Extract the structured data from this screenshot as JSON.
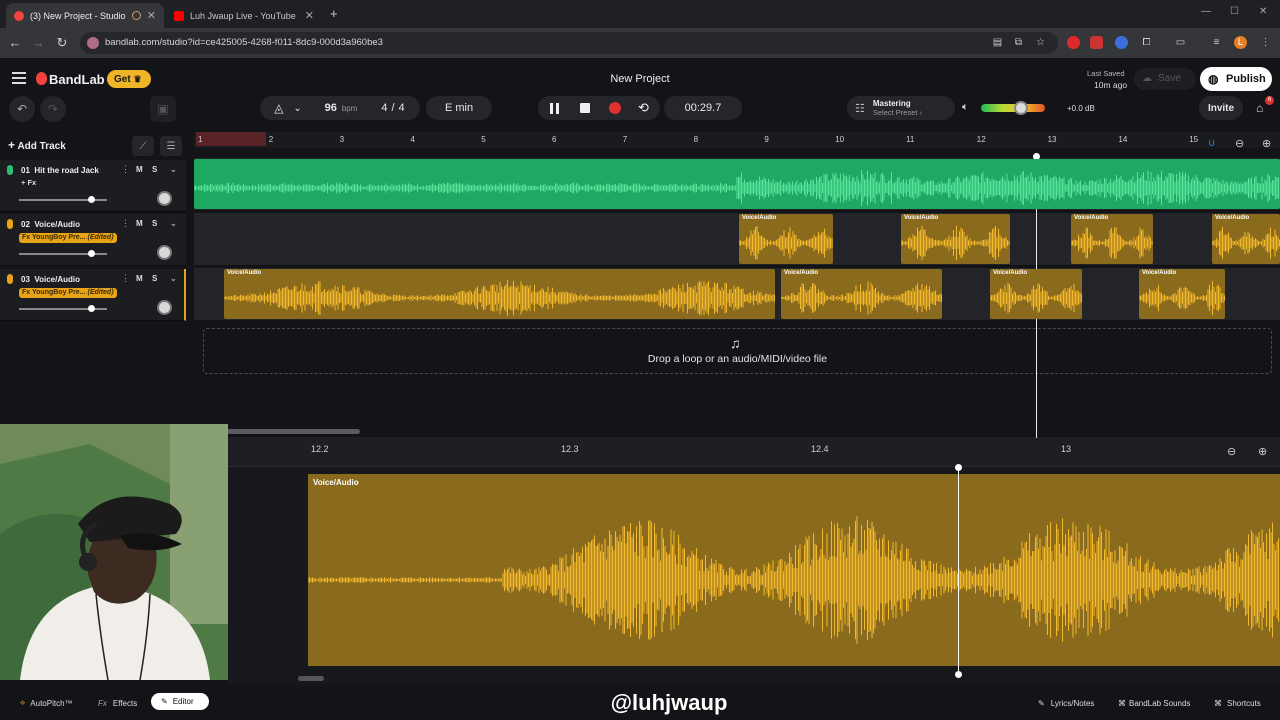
{
  "browser": {
    "tabs": [
      {
        "title": "(3) New Project - Studio",
        "active": true
      },
      {
        "title": "Luh Jwaup Live - YouTube",
        "active": false
      }
    ],
    "new_tab": "+",
    "url": "bandlab.com/studio?id=ce425005-4268-f011-8dc9-000d3a960be3",
    "profile_initial": "L"
  },
  "app": {
    "logo": "BandLab",
    "get_label": "Get",
    "project_title": "New Project",
    "last_saved_label": "Last Saved",
    "last_saved_time": "10m ago",
    "save_label": "Save",
    "publish_label": "Publish",
    "invite_label": "Invite",
    "gift_badge": "6"
  },
  "transport": {
    "bpm": "96",
    "bpm_unit": "bpm",
    "time_sig_num": "4",
    "time_sig_sep": "/",
    "time_sig_den": "4",
    "key": "E min",
    "time": "00:29.7",
    "mastering_label": "Mastering",
    "mastering_preset": "Select Preset",
    "master_db": "+0.0 dB",
    "master_level": 0.62
  },
  "tracks": [
    {
      "number": "01",
      "name": "Hit the road Jack",
      "fx": "+ Fx",
      "fx_edited": "",
      "mute": "M",
      "solo": "S",
      "color": "#2bbf72",
      "volume": 0.78
    },
    {
      "number": "02",
      "name": "Voice/Audio",
      "fx": "Fx YoungBoy Pre...",
      "fx_edited": "(Edited)",
      "mute": "M",
      "solo": "S",
      "color": "#e8a317",
      "volume": 0.78
    },
    {
      "number": "03",
      "name": "Voice/Audio",
      "fx": "Fx YoungBoy Pre...",
      "fx_edited": "(Edited)",
      "mute": "M",
      "solo": "S",
      "color": "#e8a317",
      "volume": 0.78
    }
  ],
  "add_track_label": "Add Track",
  "ruler": [
    "1",
    "2",
    "3",
    "4",
    "5",
    "6",
    "7",
    "8",
    "9",
    "10",
    "11",
    "12",
    "13",
    "14",
    "15"
  ],
  "clips": {
    "label": "Voice/Audio"
  },
  "dropzone": "Drop a loop or an audio/MIDI/video file",
  "editor": {
    "ruler": [
      "12.2",
      "12.3",
      "12.4",
      "13"
    ],
    "clip_label": "Voice/Audio"
  },
  "bottom": {
    "autopitch": "AutoPitch™",
    "effects": "Effects",
    "editor": "Editor",
    "watermark": "@luhjwaup",
    "lyrics": "Lyrics/Notes",
    "sounds": "BandLab Sounds",
    "shortcuts": "Shortcuts"
  }
}
